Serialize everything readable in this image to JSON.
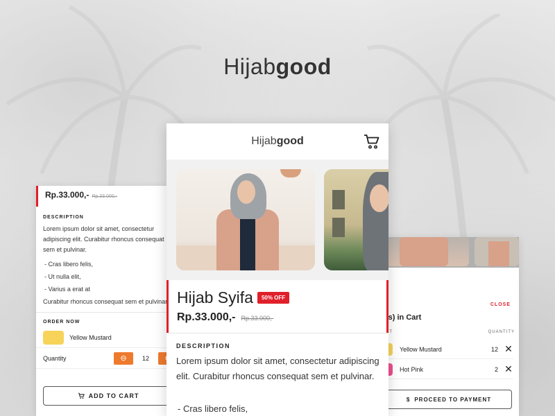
{
  "brand": {
    "regular": "Hijab",
    "bold": "good"
  },
  "left_card": {
    "price": "Rp.33.000,-",
    "old_price": "Rp.33.000,-",
    "description_heading": "DESCRIPTION",
    "description_text": "Lorem ipsum dolor sit amet, consectetur adipiscing elit. Curabitur rhoncus consequat sem et pulvinar.",
    "list": [
      "- Cras libero felis,",
      "- Ut nulla elit,",
      "- Varius a erat at"
    ],
    "extra_line": "Curabitur rhoncus consequat sem et pulvinar",
    "order_heading": "ORDER NOW",
    "variant": {
      "name": "Yellow Mustard",
      "color": "#f7d35a"
    },
    "quantity_label": "Quantity",
    "quantity_value": "12",
    "add_to_cart": "ADD TO CART"
  },
  "center_card": {
    "logo_regular": "Hijab",
    "logo_bold": "good",
    "product_title": "Hijab Syifa",
    "badge": "50% OFF",
    "price": "Rp.33.000,-",
    "old_price": "Rp.33.000,-",
    "description_heading": "DESCRIPTION",
    "description_text": "Lorem ipsum dolor sit amet, consectetur adipiscing elit. Curabitur rhoncus consequat sem et pulvinar.",
    "list_first": "- Cras libero felis,"
  },
  "right_card": {
    "close": "CLOSE",
    "cart_title": "(s) in Cart",
    "col_product": "NT",
    "col_quantity": "QUANTITY",
    "items": [
      {
        "name": "Yellow Mustard",
        "qty": "12",
        "color": "#f7d35a"
      },
      {
        "name": "Hot Pink",
        "qty": "2",
        "color": "#ef4f8f"
      }
    ],
    "remove_glyph": "✕",
    "pay_button": "PROCEED TO PAYMENT"
  },
  "colors": {
    "accent": "#e0202a",
    "orange": "#ee7a2e"
  }
}
